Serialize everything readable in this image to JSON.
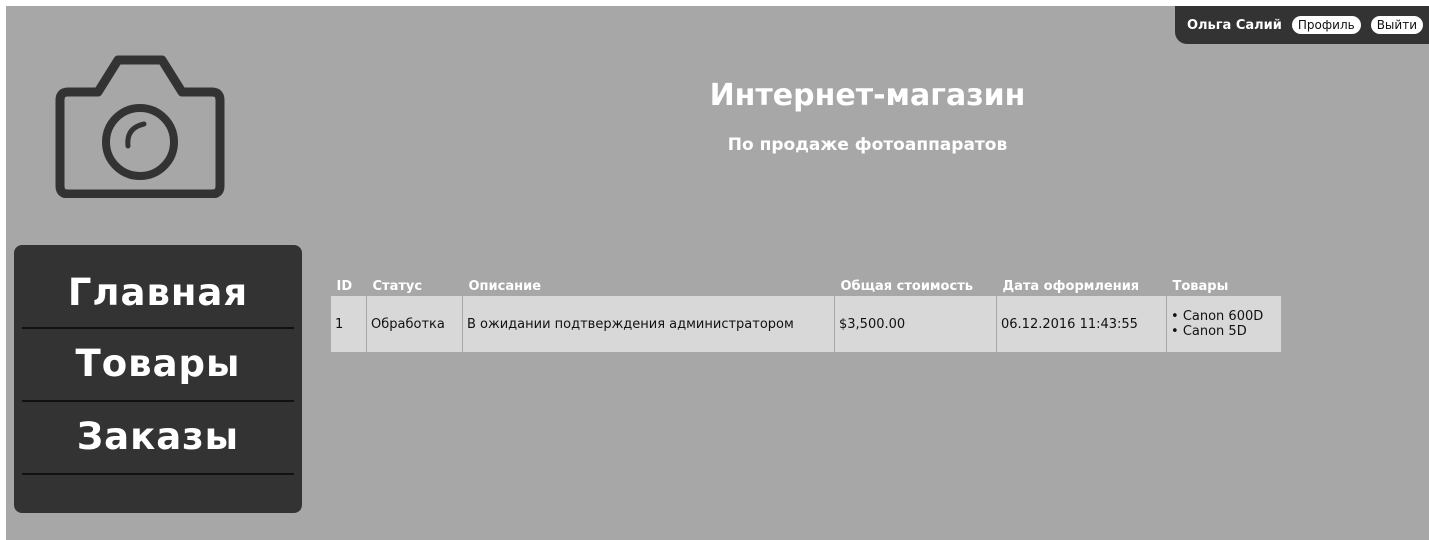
{
  "user": {
    "name": "Ольга Салий",
    "profile_label": "Профиль",
    "logout_label": "Выйти"
  },
  "header": {
    "title": "Интернет-магазин",
    "subtitle": "По продаже фотоаппаратов"
  },
  "nav": {
    "items": [
      {
        "label": "Главная"
      },
      {
        "label": "Товары"
      },
      {
        "label": "Заказы"
      }
    ]
  },
  "orders": {
    "columns": {
      "id": "ID",
      "status": "Статус",
      "description": "Описание",
      "total": "Общая стоимость",
      "date": "Дата оформления",
      "items": "Товары"
    },
    "rows": [
      {
        "id": "1",
        "status": "Обработка",
        "description": "В ожидании подтверждения администратором",
        "total": "$3,500.00",
        "date": "06.12.2016 11:43:55",
        "items": [
          "Canon 600D",
          "Canon 5D"
        ]
      }
    ]
  },
  "icons": {
    "logo": "camera-icon"
  },
  "colors": {
    "background": "#a7a7a7",
    "panel": "#333333",
    "row": "#d8d8d8"
  }
}
